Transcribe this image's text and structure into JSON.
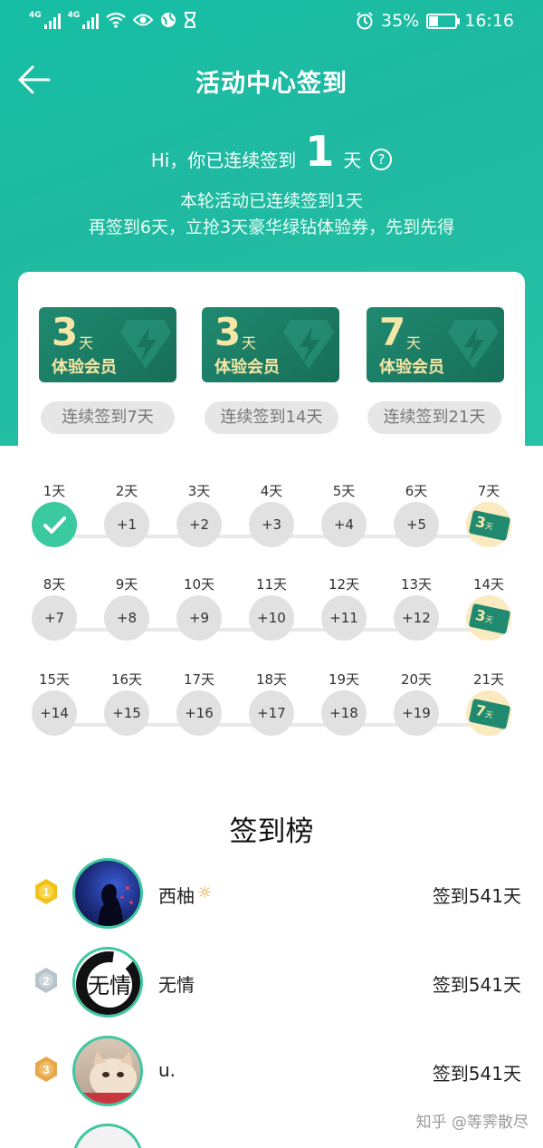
{
  "status_bar": {
    "signal_1": "4G",
    "signal_2": "4G",
    "battery_percent": "35%",
    "battery_level": 0.35,
    "time": "16:16",
    "icons": [
      "wifi-icon",
      "eye-icon",
      "globe-icon",
      "hourglass-icon",
      "alarm-icon",
      "battery-icon"
    ]
  },
  "header": {
    "title": "活动中心签到",
    "back_icon": "arrow-left-icon"
  },
  "streak": {
    "prefix": "Hi，你已连续签到",
    "count": "1",
    "suffix": "天",
    "help": "?",
    "line1": "本轮活动已连续签到1天",
    "line2": "再签到6天，立抢3天豪华绿钻体验券，先到先得"
  },
  "rewards": [
    {
      "days": "3",
      "unit": "天",
      "label": "体验会员",
      "condition": "连续签到7天"
    },
    {
      "days": "3",
      "unit": "天",
      "label": "体验会员",
      "condition": "连续签到14天"
    },
    {
      "days": "7",
      "unit": "天",
      "label": "体验会员",
      "condition": "连续签到21天"
    }
  ],
  "checkin": {
    "rows": [
      [
        {
          "label": "1天",
          "text": "",
          "state": "done"
        },
        {
          "label": "2天",
          "text": "+1",
          "state": "normal"
        },
        {
          "label": "3天",
          "text": "+2",
          "state": "normal"
        },
        {
          "label": "4天",
          "text": "+3",
          "state": "normal"
        },
        {
          "label": "5天",
          "text": "+4",
          "state": "normal"
        },
        {
          "label": "6天",
          "text": "+5",
          "state": "normal"
        },
        {
          "label": "7天",
          "text": "3",
          "state": "gift"
        }
      ],
      [
        {
          "label": "8天",
          "text": "+7",
          "state": "normal"
        },
        {
          "label": "9天",
          "text": "+8",
          "state": "normal"
        },
        {
          "label": "10天",
          "text": "+9",
          "state": "normal"
        },
        {
          "label": "11天",
          "text": "+10",
          "state": "normal"
        },
        {
          "label": "12天",
          "text": "+11",
          "state": "normal"
        },
        {
          "label": "13天",
          "text": "+12",
          "state": "normal"
        },
        {
          "label": "14天",
          "text": "3",
          "state": "gift"
        }
      ],
      [
        {
          "label": "15天",
          "text": "+14",
          "state": "normal"
        },
        {
          "label": "16天",
          "text": "+15",
          "state": "normal"
        },
        {
          "label": "17天",
          "text": "+16",
          "state": "normal"
        },
        {
          "label": "18天",
          "text": "+17",
          "state": "normal"
        },
        {
          "label": "19天",
          "text": "+18",
          "state": "normal"
        },
        {
          "label": "20天",
          "text": "+19",
          "state": "normal"
        },
        {
          "label": "21天",
          "text": "7",
          "state": "gift"
        }
      ]
    ],
    "gift_unit": "天"
  },
  "leaderboard": {
    "title": "签到榜",
    "entries": [
      {
        "rank": "1",
        "name": "西柚",
        "days": "签到541天",
        "badge": "sun-icon"
      },
      {
        "rank": "2",
        "name": "无情",
        "days": "签到541天"
      },
      {
        "rank": "3",
        "name": "u.",
        "days": "签到541天"
      }
    ],
    "avatar2_text": "无情"
  },
  "colors": {
    "accent": "#1dbfa3",
    "ticket": "#1f8a70",
    "ticket_text": "#f6e6a6",
    "gift_bg": "#fbeac0",
    "medal_gold": "#f2c21a",
    "medal_silver": "#b8c4cc",
    "medal_bronze": "#e8a84a"
  },
  "watermark": "知乎 @等霁散尽"
}
